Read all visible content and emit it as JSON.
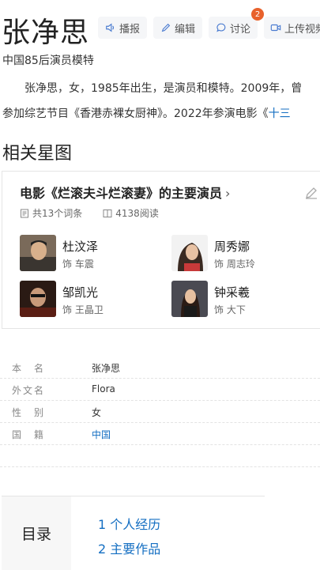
{
  "header": {
    "title": "张净思",
    "buttons": {
      "broadcast": "播报",
      "edit": "编辑",
      "discuss": "讨论",
      "upload": "上传视频"
    },
    "discuss_badge": "2"
  },
  "subtitle": "中国85后演员模特",
  "summary": {
    "line1": "张净思，女，1985年出生，是演员和模特。2009年，曾",
    "line2_text": "参加综艺节目《香港赤裸女厨神》。2022年参演电影《",
    "line2_link": "十三"
  },
  "related": {
    "heading": "相关星图",
    "card_title": "电影《烂滚夫斗烂滚妻》的主要演员",
    "chevron": "›",
    "entries_count": "共13个词条",
    "reads_count": "4138阅读",
    "actors": [
      {
        "name": "杜汶泽",
        "role": "饰 车震"
      },
      {
        "name": "周秀娜",
        "role": "饰 周志玲"
      },
      {
        "name": "邹凯光",
        "role": "饰 王晶卫"
      },
      {
        "name": "钟采羲",
        "role": "饰 大下"
      }
    ]
  },
  "info": [
    {
      "key": "本　名",
      "value": "张净思"
    },
    {
      "key": "外文名",
      "value": "Flora"
    },
    {
      "key": "性　别",
      "value": "女"
    },
    {
      "key": "国　籍",
      "value": "中国"
    }
  ],
  "toc": {
    "heading": "目录",
    "items": [
      "1  个人经历",
      "2  主要作品"
    ]
  },
  "colors": {
    "link": "#136ec2",
    "badge": "#e8612c"
  }
}
